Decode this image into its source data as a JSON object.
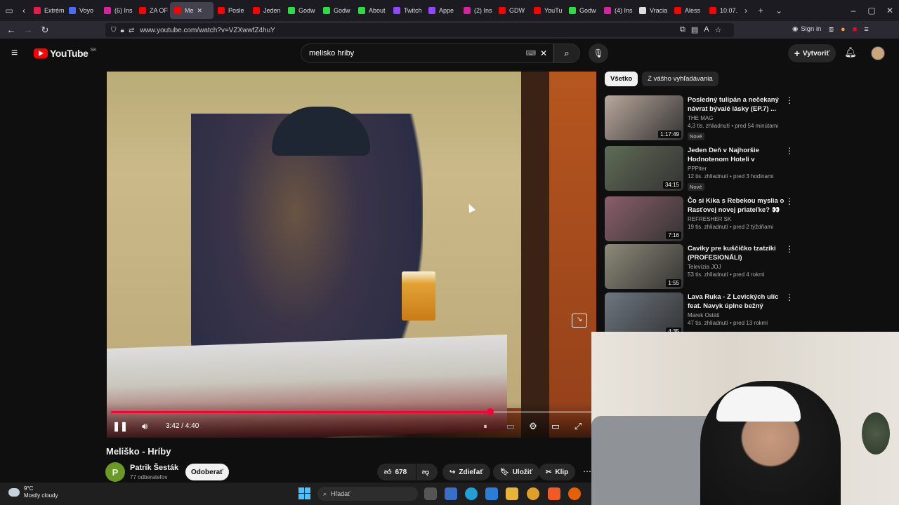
{
  "browser": {
    "tabs": [
      {
        "label": "Extrém",
        "color": "#e61b48"
      },
      {
        "label": "Voyo",
        "color": "#4a6cf7"
      },
      {
        "label": "(6) Ins",
        "color": "#d6249f"
      },
      {
        "label": "ZA OF",
        "color": "#ff0000"
      },
      {
        "label": "Me",
        "color": "#ff0000",
        "active": true
      },
      {
        "label": "Posle",
        "color": "#ff0000"
      },
      {
        "label": "Jeden",
        "color": "#ff0000"
      },
      {
        "label": "Godw",
        "color": "#2bdc43"
      },
      {
        "label": "Godw",
        "color": "#2bdc43"
      },
      {
        "label": "About",
        "color": "#2bdc43"
      },
      {
        "label": "Twitch",
        "color": "#9146ff"
      },
      {
        "label": "Appe",
        "color": "#9146ff"
      },
      {
        "label": "(2) Ins",
        "color": "#d6249f"
      },
      {
        "label": "GDW",
        "color": "#ff0000"
      },
      {
        "label": "YouTu",
        "color": "#ff0000"
      },
      {
        "label": "Godw",
        "color": "#2bdc43"
      },
      {
        "label": "(4) Ins",
        "color": "#d6249f"
      },
      {
        "label": "Vracia",
        "color": "#dddddd"
      },
      {
        "label": "Aless",
        "color": "#ff0000"
      },
      {
        "label": "10.07.",
        "color": "#ff0000"
      }
    ],
    "url": "www.youtube.com/watch?v=VZXwwfZ4huY",
    "signin": "Sign in"
  },
  "yt": {
    "logo": "YouTube",
    "country": "SK",
    "search_value": "melisko hriby",
    "create_label": "Vytvoriť"
  },
  "player": {
    "time": "3:42 / 4:40",
    "progress": 0.79
  },
  "video": {
    "title": "Meliško - Hríby",
    "channel": "Patrik Šesták",
    "channel_initial": "P",
    "subscribers": "77 odberateľov",
    "subscribe_label": "Odoberať",
    "likes": "678",
    "share_label": "Zdieľať",
    "save_label": "Uložiť",
    "clip_label": "Klip"
  },
  "chips": [
    "Všetko",
    "Z vášho vyhľadávania"
  ],
  "recommendations": [
    {
      "title": "Posledný tulipán a nečekaný návrat bývalé lásky (EP.7) ...",
      "channel": "THE MAG",
      "meta": "4,3 tis. zhliadnutí • pred 54 minútami",
      "badge": "Nové",
      "duration": "1:17:49",
      "thumb_color": "#b9a79c"
    },
    {
      "title": "Jeden Deň v Najhoršie Hodnotenom Hoteli v Kalifornii...",
      "channel": "PPPiter",
      "meta": "12 tis. zhliadnutí • pred 3 hodinami",
      "badge": "Nové",
      "duration": "34:15",
      "thumb_color": "#5f6b55"
    },
    {
      "title": "Čo si Kika s Rebekou myslia o Rasťovej novej priateľke? 👀 ...",
      "channel": "REFRESHER SK",
      "meta": "19 tis. zhliadnutí • pred 2 týždňami",
      "badge": "",
      "duration": "7:16",
      "thumb_color": "#8a5e6a"
    },
    {
      "title": "Caviky pre kuščičko tzatziki (PROFESIONÁLI)",
      "channel": "Televízia JOJ",
      "meta": "53 tis. zhliadnutí • pred 4 rokmi",
      "badge": "",
      "duration": "1:55",
      "thumb_color": "#8e8a78"
    },
    {
      "title": "Lava Ruka - Z Levických ulíc feat. Navyk úplne bežný",
      "channel": "Marek Ostáš",
      "meta": "47 tis. zhliadnutí • pred 13 rokmi",
      "badge": "",
      "duration": "4:35",
      "thumb_color": "#6d7681"
    }
  ],
  "taskbar": {
    "temp": "9°C",
    "weather": "Mostly cloudy",
    "search_placeholder": "Hľadať"
  }
}
